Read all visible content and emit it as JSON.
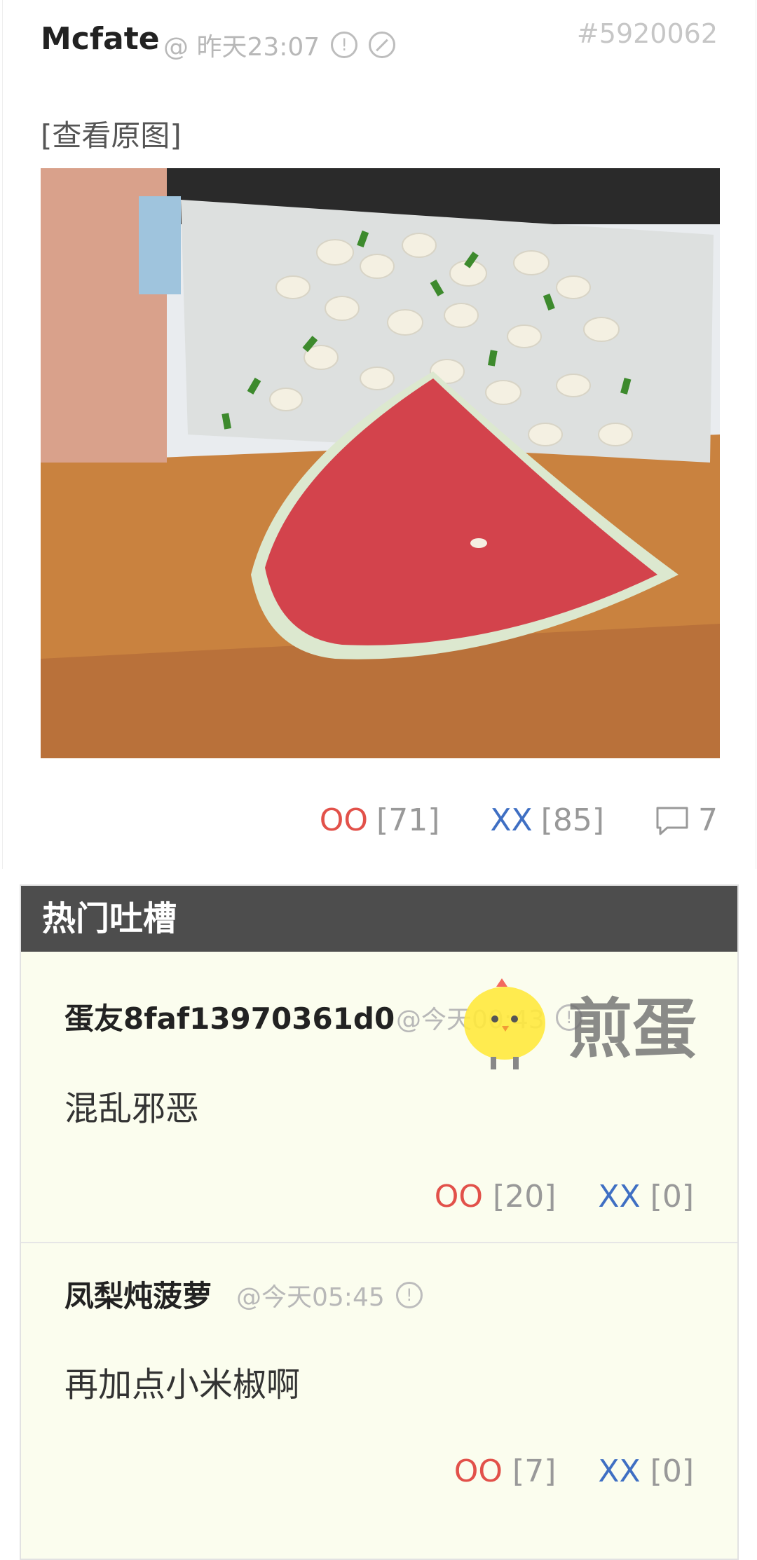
{
  "post": {
    "author": "Mcfate",
    "time": "@ 昨天23:07",
    "id": "#5920062",
    "view_original": "[查看原图]",
    "oo_label": "OO",
    "oo_count": "[71]",
    "xx_label": "XX",
    "xx_count": "[85]",
    "comments": "7"
  },
  "hot": {
    "title": "热门吐槽",
    "comments": [
      {
        "author": "蛋友8faf13970361d0",
        "time": "@今天00:43",
        "text": "混乱邪恶",
        "oo_label": "OO",
        "oo": "[20]",
        "xx_label": "XX",
        "xx": "[0]"
      },
      {
        "author": "凤梨炖菠萝",
        "time": "@今天05:45",
        "text": "再加点小米椒啊",
        "oo_label": "OO",
        "oo": "[7]",
        "xx_label": "XX",
        "xx": "[0]"
      }
    ]
  },
  "watermark": "煎蛋",
  "colors": {
    "oo": "#e2514a",
    "xx": "#3f6fc3",
    "hot_header": "#4d4d4d",
    "hot_bg": "#fbfdee"
  }
}
